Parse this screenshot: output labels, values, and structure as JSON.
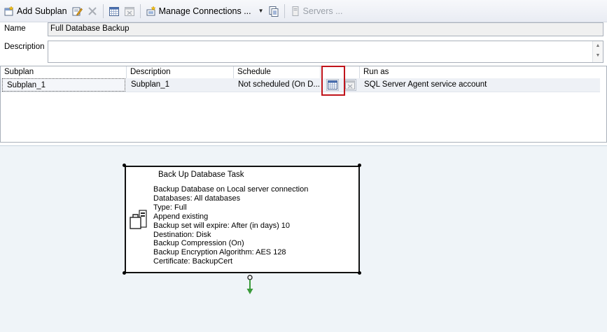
{
  "toolbar": {
    "add_subplan": "Add Subplan",
    "manage_connections": "Manage Connections ...",
    "servers": "Servers ..."
  },
  "form": {
    "name_label": "Name",
    "name_value": "Full Database Backup",
    "description_label": "Description",
    "description_value": ""
  },
  "grid": {
    "columns": [
      "Subplan",
      "Description",
      "Schedule",
      "",
      "Run as"
    ],
    "rows": [
      {
        "subplan": "Subplan_1",
        "description": "Subplan_1",
        "schedule": "Not scheduled (On D...",
        "run_as": "SQL Server Agent service account"
      }
    ]
  },
  "task": {
    "title": "Back Up Database Task",
    "lines": [
      "Backup Database on Local server connection",
      "Databases: All databases",
      "Type: Full",
      "Append existing",
      "Backup set will expire: After (in days) 10",
      "Destination: Disk",
      "Backup Compression (On)",
      "Backup Encryption Algorithm: AES 128",
      "Certificate: BackupCert"
    ]
  },
  "colors": {
    "highlight": "#c0141b",
    "designer_bg": "#eff4f8",
    "connector": "#3a9a3a"
  }
}
